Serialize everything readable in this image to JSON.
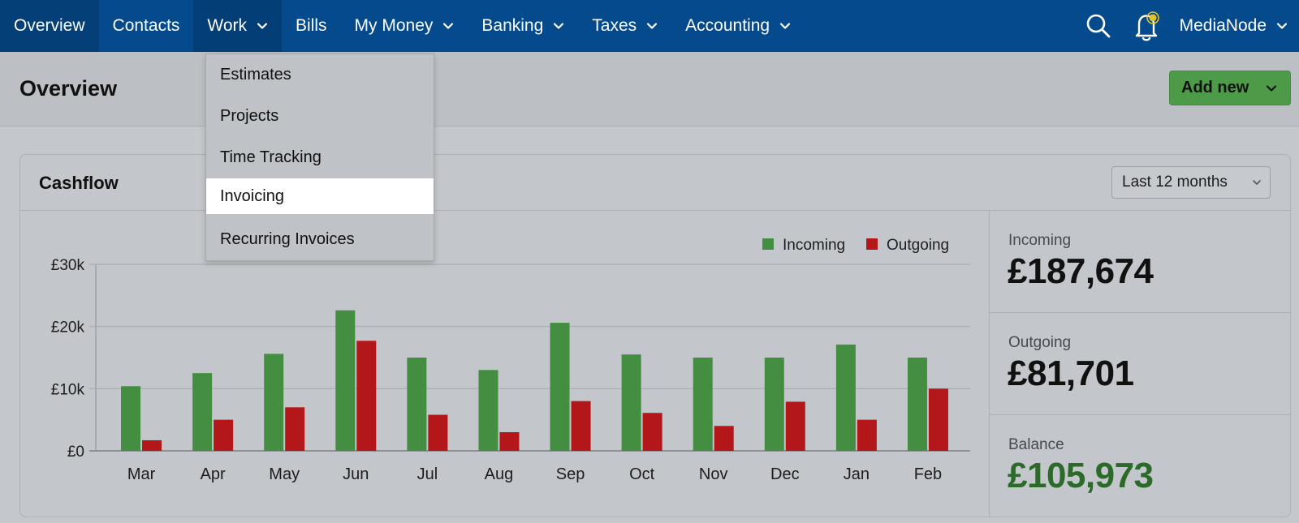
{
  "nav": {
    "items": [
      {
        "label": "Overview",
        "dropdown": false
      },
      {
        "label": "Contacts",
        "dropdown": false
      },
      {
        "label": "Work",
        "dropdown": true
      },
      {
        "label": "Bills",
        "dropdown": false
      },
      {
        "label": "My Money",
        "dropdown": true
      },
      {
        "label": "Banking",
        "dropdown": true
      },
      {
        "label": "Taxes",
        "dropdown": true
      },
      {
        "label": "Accounting",
        "dropdown": true
      }
    ],
    "account_label": "MediaNode",
    "icons": [
      "search-icon",
      "bell-icon"
    ],
    "color": "#054a8c"
  },
  "work_menu": {
    "items": [
      "Estimates",
      "Projects",
      "Time Tracking",
      "Invoicing",
      "Recurring Invoices"
    ],
    "highlighted": "Invoicing"
  },
  "page": {
    "title": "Overview",
    "add_new_label": "Add new"
  },
  "cashflow": {
    "title": "Cashflow",
    "period": "Last 12 months",
    "stats": {
      "incoming_label": "Incoming",
      "incoming_value": "£187,674",
      "outgoing_label": "Outgoing",
      "outgoing_value": "£81,701",
      "balance_label": "Balance",
      "balance_value": "£105,973"
    }
  },
  "chart_data": {
    "type": "bar",
    "categories": [
      "Mar",
      "Apr",
      "May",
      "Jun",
      "Jul",
      "Aug",
      "Sep",
      "Oct",
      "Nov",
      "Dec",
      "Jan",
      "Feb"
    ],
    "series": [
      {
        "name": "Incoming",
        "color": "#448e42",
        "values": [
          10400,
          12500,
          15600,
          22600,
          15000,
          13000,
          20600,
          15500,
          15000,
          15000,
          17100,
          15000
        ]
      },
      {
        "name": "Outgoing",
        "color": "#b3171a",
        "values": [
          1700,
          5000,
          7000,
          17700,
          5800,
          3000,
          8000,
          6100,
          4000,
          7900,
          5000,
          10000
        ]
      }
    ],
    "y_ticks": [
      "£0",
      "£10k",
      "£20k",
      "£30k"
    ],
    "ylim": [
      0,
      30000
    ],
    "legend": "top-right",
    "grid": true
  }
}
